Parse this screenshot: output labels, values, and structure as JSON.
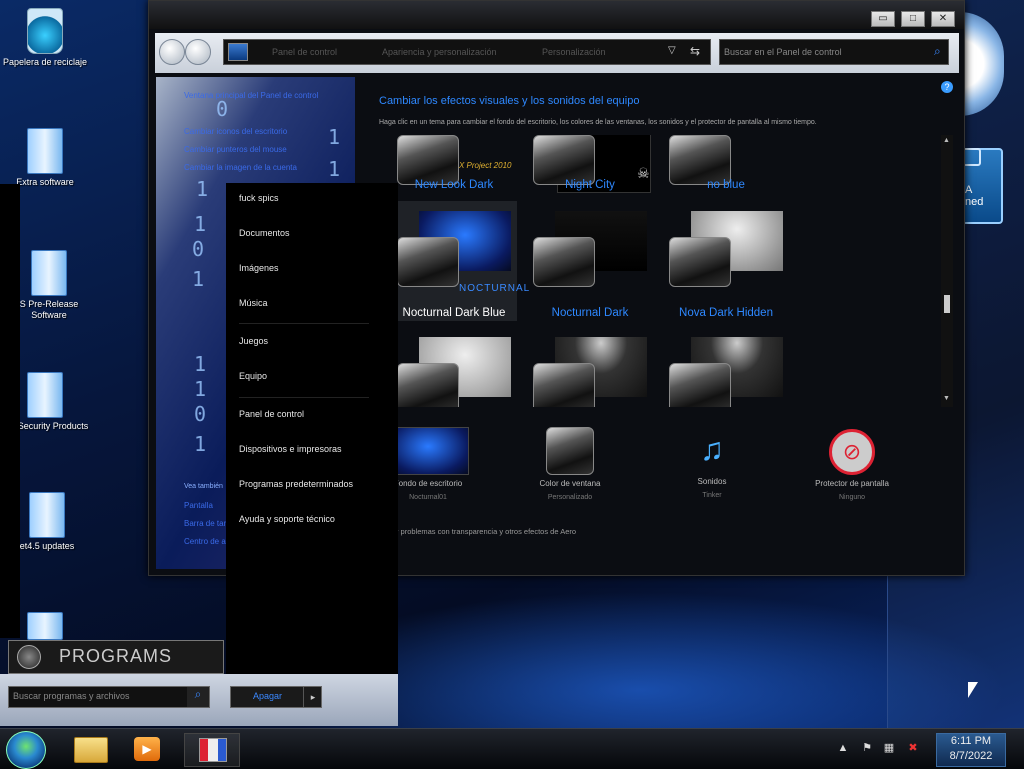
{
  "desktop": {
    "icons": [
      {
        "label": "Papelera de reciclaje",
        "kind": "recycle-bin"
      },
      {
        "label": "Extra software",
        "kind": "folder"
      },
      {
        "label": "S Pre-Release Software",
        "kind": "folder"
      },
      {
        "label": "MS Security Products",
        "kind": "folder"
      },
      {
        "label": "et4.5 updates",
        "kind": "folder"
      },
      {
        "label": "",
        "kind": "folder"
      }
    ]
  },
  "window": {
    "controls": {
      "minimize": "▭",
      "maximize": "□",
      "close": "✕"
    },
    "breadcrumb": [
      "Panel de control",
      "Apariencia y personalización",
      "Personalización"
    ],
    "search_placeholder": "Buscar en el Panel de control",
    "sidebar": {
      "links": [
        "Ventana principal del Panel de control",
        "Cambiar iconos del escritorio",
        "Cambiar punteros del mouse",
        "Cambiar la imagen de la cuenta"
      ],
      "see_also_title": "Vea también",
      "see_also": [
        "Pantalla",
        "Barra de tareas",
        "Centro de accesibilidad"
      ]
    },
    "content": {
      "title": "Cambiar los efectos visuales y los sonidos del equipo",
      "subtitle": "Haga clic en un tema para cambiar el fondo del escritorio, los colores de las ventanas, los sonidos y el protector de pantalla al mismo tiempo.",
      "themes": [
        {
          "name": "New Look Dark",
          "overlay": "X Project 2010",
          "selected": false
        },
        {
          "name": "Night City",
          "overlay": "",
          "selected": false
        },
        {
          "name": "no blue",
          "overlay": "",
          "selected": false
        },
        {
          "name": "Nocturnal Dark Blue",
          "overlay": "NOCTURNAL",
          "selected": true
        },
        {
          "name": "Nocturnal Dark",
          "overlay": "",
          "selected": false
        },
        {
          "name": "Nova Dark Hidden",
          "overlay": "",
          "selected": false
        },
        {
          "name": "",
          "overlay": "",
          "selected": false
        },
        {
          "name": "",
          "overlay": "",
          "selected": false
        },
        {
          "name": "",
          "overlay": "",
          "selected": false
        }
      ],
      "settings": [
        {
          "title": "Fondo de escritorio",
          "value": "Nocturnal01"
        },
        {
          "title": "Color de ventana",
          "value": "Personalizado"
        },
        {
          "title": "Sonidos",
          "value": "Tinker"
        },
        {
          "title": "Protector de pantalla",
          "value": "Ninguno"
        }
      ],
      "aero_link": "Solucionar problemas con transparencia y otros efectos de Aero"
    }
  },
  "start_menu": {
    "items": [
      "fuck spics",
      "Documentos",
      "Imágenes",
      "Música",
      "Juegos",
      "Equipo",
      "Panel de control",
      "Dispositivos e impresoras",
      "Programas predeterminados",
      "Ayuda y soporte técnico"
    ],
    "programs_label": "PROGRAMS",
    "search_placeholder": "Buscar programas y archivos",
    "shutdown_label": "Apagar",
    "shutdown_arrow": "▸"
  },
  "gadget": {
    "text": "A\nned"
  },
  "taskbar": {
    "pinned": [
      "explorer",
      "media-player",
      "personalization"
    ],
    "tray_arrow": "▲",
    "time": "6:11 PM",
    "date": "8/7/2022"
  },
  "colors": {
    "accent": "#2e88ff",
    "selected_tile": "#1f2227"
  }
}
